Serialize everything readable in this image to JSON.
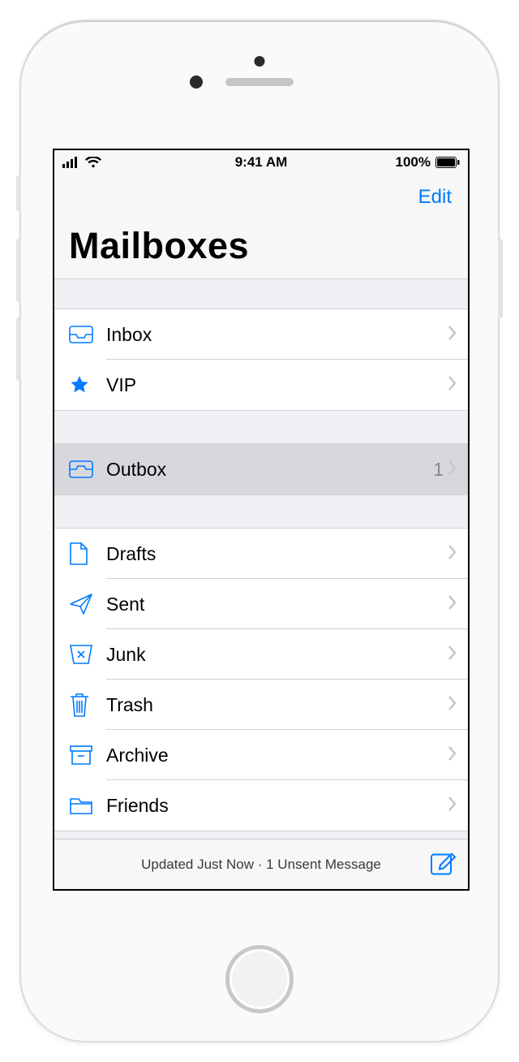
{
  "statusbar": {
    "time": "9:41 AM",
    "battery": "100%"
  },
  "nav": {
    "edit": "Edit"
  },
  "title": "Mailboxes",
  "group1": [
    {
      "icon": "inbox-icon",
      "label": "Inbox"
    },
    {
      "icon": "star-icon",
      "label": "VIP"
    }
  ],
  "group2": [
    {
      "icon": "outbox-icon",
      "label": "Outbox",
      "count": "1",
      "selected": true
    }
  ],
  "group3": [
    {
      "icon": "drafts-icon",
      "label": "Drafts"
    },
    {
      "icon": "sent-icon",
      "label": "Sent"
    },
    {
      "icon": "junk-icon",
      "label": "Junk"
    },
    {
      "icon": "trash-icon",
      "label": "Trash"
    },
    {
      "icon": "archive-icon",
      "label": "Archive"
    },
    {
      "icon": "folder-icon",
      "label": "Friends"
    }
  ],
  "toolbar": {
    "status": "Updated Just Now · 1 Unsent Message"
  },
  "colors": {
    "tint": "#007aff"
  }
}
